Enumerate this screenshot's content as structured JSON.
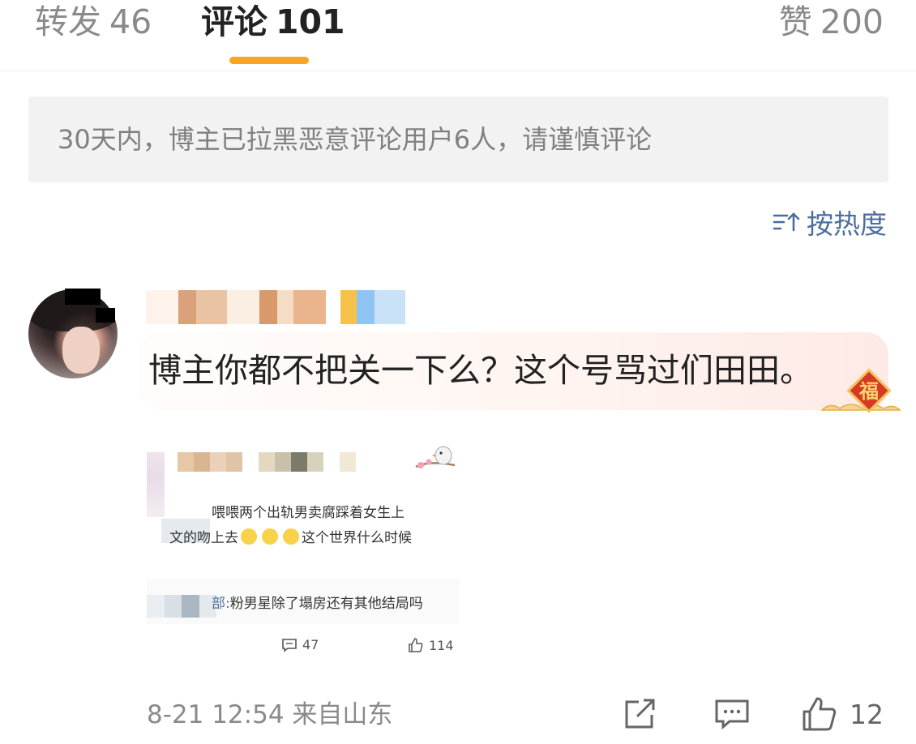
{
  "tabs": {
    "repost_label": "转发",
    "repost_count": "46",
    "comment_label": "评论",
    "comment_count": "101",
    "like_label": "赞",
    "like_count": "200",
    "active_color": "#f5a623"
  },
  "notice": {
    "text": "30天内，博主已拉黑恶意评论用户6人，请谨慎评论"
  },
  "sort": {
    "label": "按热度",
    "icon": "sort-icon"
  },
  "comment": {
    "text": "博主你都不把关一下么？这个号骂过们田田。",
    "badge": "福",
    "embedded": {
      "line1": "喂喂两个出轨男卖腐踩着女生上",
      "line2_a": "文的吻上去",
      "line2_b": "这个世界什么时候",
      "sub_author": "部:",
      "sub_text": "粉男星除了塌房还有其他结局吗",
      "comment_count": "47",
      "like_count": "114"
    },
    "meta": "8-21 12:54 来自山东",
    "like_count": "12"
  },
  "colors": {
    "link": "#4b6e9b",
    "muted": "#8a8a8a",
    "notice_bg": "#f2f2f2"
  }
}
